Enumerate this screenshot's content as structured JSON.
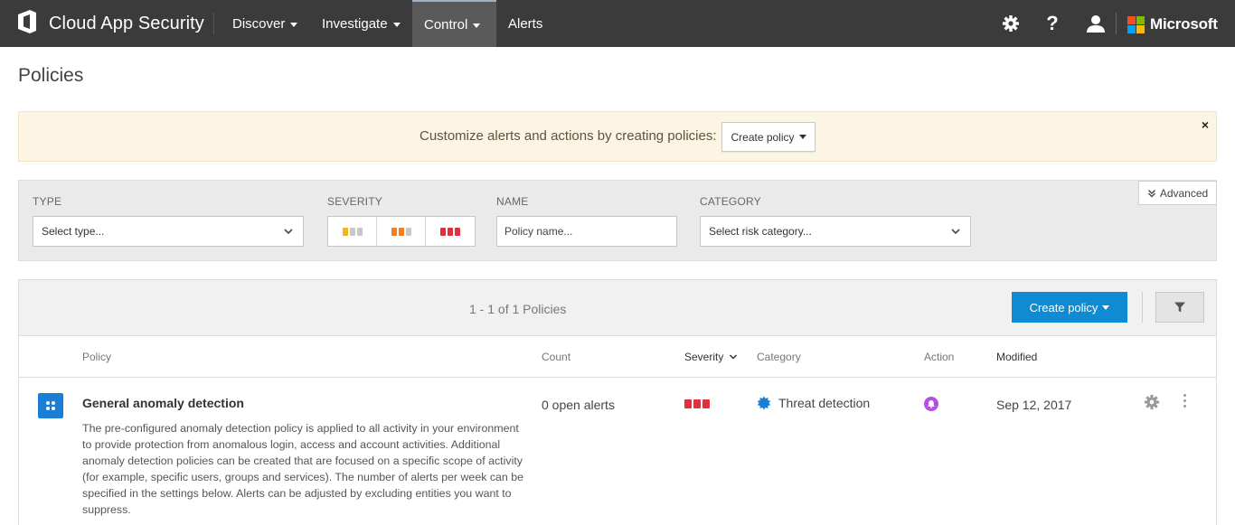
{
  "header": {
    "app_name": "Cloud App Security",
    "nav": [
      {
        "label": "Discover"
      },
      {
        "label": "Investigate"
      },
      {
        "label": "Control"
      },
      {
        "label": "Alerts"
      }
    ],
    "active_nav": "Control",
    "icons": [
      "settings-gear-icon",
      "help-question-icon",
      "user-icon"
    ],
    "brand": "Microsoft"
  },
  "page": {
    "title": "Policies"
  },
  "banner": {
    "text": "Customize alerts and actions by creating policies:",
    "button_label": "Create policy",
    "close_glyph": "×"
  },
  "filters": {
    "type": {
      "label": "TYPE",
      "value": "Select type..."
    },
    "severity": {
      "label": "SEVERITY",
      "levels": [
        "low",
        "medium",
        "high"
      ]
    },
    "name": {
      "label": "NAME",
      "placeholder": "Policy name..."
    },
    "category": {
      "label": "CATEGORY",
      "value": "Select risk category..."
    },
    "advanced_label": "Advanced"
  },
  "table": {
    "pager": "1 - 1 of 1 Policies",
    "create_button": "Create policy",
    "columns": {
      "policy": "Policy",
      "count": "Count",
      "severity": "Severity",
      "category": "Category",
      "action": "Action",
      "modified": "Modified"
    },
    "rows": [
      {
        "title": "General anomaly detection",
        "description": "The pre-configured anomaly detection policy is applied to all activity in your environment to provide protection from anomalous login, access and account activities. Additional anomaly detection policies can be created that are focused on a specific scope of activity (for example, specific users, groups and services). The number of alerts per week can be specified in the settings below. Alerts can be adjusted by excluding entities you want to suppress.",
        "count": "0 open alerts",
        "severity": "high",
        "category": "Threat detection",
        "modified": "Sep 12, 2017"
      }
    ]
  },
  "colors": {
    "topbar": "#3b3b3b",
    "accent": "#0e8bd2",
    "sev_low": "#f0b51b",
    "sev_medium": "#ef7e24",
    "sev_high": "#e0303e",
    "sev_inactive": "#c8c8c8",
    "action_purple": "#b44fe1"
  }
}
